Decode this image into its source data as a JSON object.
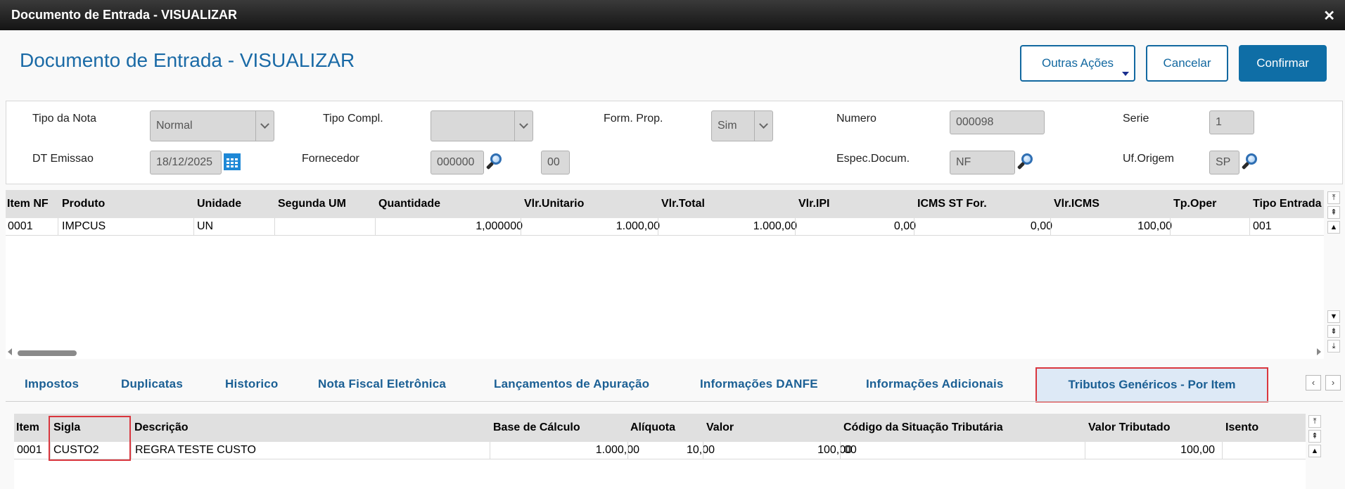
{
  "window": {
    "title": "Documento de Entrada - VISUALIZAR",
    "close_glyph": "✕"
  },
  "page": {
    "title": "Documento de Entrada - VISUALIZAR"
  },
  "actions": {
    "other": "Outras Ações",
    "cancel": "Cancelar",
    "confirm": "Confirmar"
  },
  "header": {
    "tipo_nota": {
      "label": "Tipo da Nota",
      "value": "Normal"
    },
    "tipo_compl": {
      "label": "Tipo Compl.",
      "value": ""
    },
    "form_prop": {
      "label": "Form. Prop.",
      "value": "Sim"
    },
    "numero": {
      "label": "Numero",
      "value": "000098"
    },
    "serie": {
      "label": "Serie",
      "value": "1"
    },
    "dt_emissao": {
      "label": "DT Emissao",
      "value": "18/12/2025"
    },
    "fornecedor": {
      "label": "Fornecedor",
      "value": "000000",
      "loja": "00"
    },
    "espec_docum": {
      "label": "Espec.Docum.",
      "value": "NF"
    },
    "uf_origem": {
      "label": "Uf.Origem",
      "value": "SP"
    }
  },
  "items_grid": {
    "columns": [
      "Item NF",
      "Produto",
      "Unidade",
      "Segunda UM",
      "Quantidade",
      "Vlr.Unitario",
      "Vlr.Total",
      "Vlr.IPI",
      "ICMS ST For.",
      "Vlr.ICMS",
      "Tp.Oper",
      "Tipo Entrada"
    ],
    "rows": [
      [
        "0001",
        "IMPCUS",
        "UN",
        "",
        "1,000000",
        "1.000,00",
        "1.000,00",
        "0,00",
        "0,00",
        "100,00",
        "",
        "001"
      ]
    ]
  },
  "tabs": [
    "Impostos",
    "Duplicatas",
    "Historico",
    "Nota Fiscal Eletrônica",
    "Lançamentos de Apuração",
    "Informações DANFE",
    "Informações Adicionais",
    "Tributos Genéricos - Por Item"
  ],
  "active_tab": "Tributos Genéricos - Por Item",
  "tributos_grid": {
    "columns": [
      "Item",
      "Sigla",
      "Descrição",
      "Base de Cálculo",
      "Alíquota",
      "Valor",
      "Código da Situação Tributária",
      "Valor Tributado",
      "Isento"
    ],
    "rows": [
      [
        "0001",
        "CUSTO2",
        "REGRA TESTE CUSTO",
        "1.000,00",
        "10,00",
        "100,00",
        "00",
        "100,00",
        ""
      ]
    ]
  },
  "colors": {
    "accent": "#1a6aa6",
    "primary_button": "#0f6ea6",
    "highlight_box": "#d9363e",
    "active_tab_bg": "#dde9f6"
  }
}
